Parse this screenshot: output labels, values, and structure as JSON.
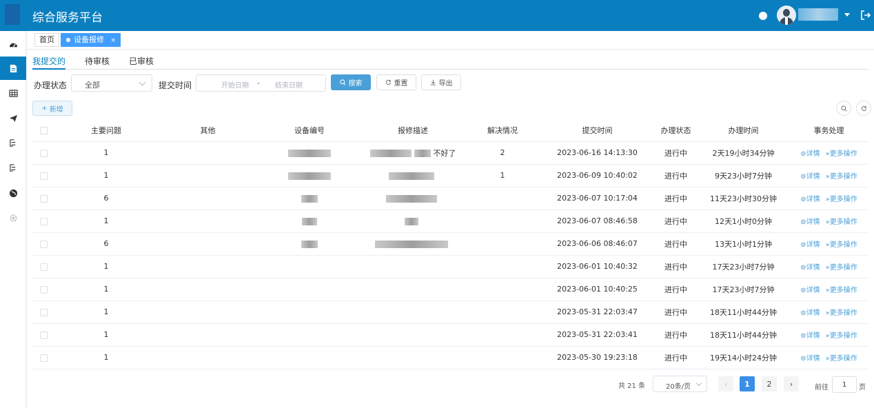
{
  "header": {
    "title": "综合服务平台"
  },
  "tabs": {
    "home": "首页",
    "active": "设备报修",
    "close": "×"
  },
  "subtabs": [
    "我提交的",
    "待审核",
    "已审核"
  ],
  "filters": {
    "status_label": "办理状态",
    "status_value": "全部",
    "time_label": "提交时间",
    "start_placeholder": "开始日期",
    "separator": "-",
    "end_placeholder": "结束日期",
    "search": "搜索",
    "reset": "重置",
    "export": "导出"
  },
  "toolbar": {
    "add": "新增"
  },
  "table": {
    "columns": [
      "主要问题",
      "其他",
      "设备编号",
      "报修描述",
      "解决情况",
      "提交时间",
      "办理状态",
      "办理时间",
      "事务处理"
    ],
    "detail_label": "详情",
    "more_label": "更多操作",
    "rows": [
      {
        "issue": "1",
        "desc_suffix": "不好了",
        "resolved": "2",
        "submitted": "2023-06-16 14:13:30",
        "status": "进行中",
        "duration": "2天19小时34分钟"
      },
      {
        "issue": "1",
        "desc_suffix": "",
        "resolved": "1",
        "submitted": "2023-06-09 10:40:02",
        "status": "进行中",
        "duration": "9天23小时7分钟"
      },
      {
        "issue": "6",
        "desc_suffix": "",
        "resolved": "",
        "submitted": "2023-06-07 10:17:04",
        "status": "进行中",
        "duration": "11天23小时30分钟"
      },
      {
        "issue": "1",
        "desc_suffix": "",
        "resolved": "",
        "submitted": "2023-06-07 08:46:58",
        "status": "进行中",
        "duration": "12天1小时0分钟"
      },
      {
        "issue": "6",
        "desc_suffix": "",
        "resolved": "",
        "submitted": "2023-06-06 08:46:07",
        "status": "进行中",
        "duration": "13天1小时1分钟"
      },
      {
        "issue": "1",
        "desc_suffix": "",
        "resolved": "",
        "submitted": "2023-06-01 10:40:32",
        "status": "进行中",
        "duration": "17天23小时7分钟"
      },
      {
        "issue": "1",
        "desc_suffix": "",
        "resolved": "",
        "submitted": "2023-06-01 10:40:25",
        "status": "进行中",
        "duration": "17天23小时7分钟"
      },
      {
        "issue": "1",
        "desc_suffix": "",
        "resolved": "",
        "submitted": "2023-05-31 22:03:47",
        "status": "进行中",
        "duration": "18天11小时44分钟"
      },
      {
        "issue": "1",
        "desc_suffix": "",
        "resolved": "",
        "submitted": "2023-05-31 22:03:41",
        "status": "进行中",
        "duration": "18天11小时44分钟"
      },
      {
        "issue": "1",
        "desc_suffix": "",
        "resolved": "",
        "submitted": "2023-05-30 19:23:18",
        "status": "进行中",
        "duration": "19天14小时24分钟"
      }
    ]
  },
  "pagination": {
    "total": "共 21 条",
    "page_size": "20条/页",
    "prev": "‹",
    "pages": [
      "1",
      "2"
    ],
    "next": "›",
    "goto_label": "前往",
    "goto_value": "1",
    "goto_suffix": "页"
  },
  "colors": {
    "header": "#0a7fc0",
    "primary": "#409eff",
    "link": "#4a9fd8"
  }
}
